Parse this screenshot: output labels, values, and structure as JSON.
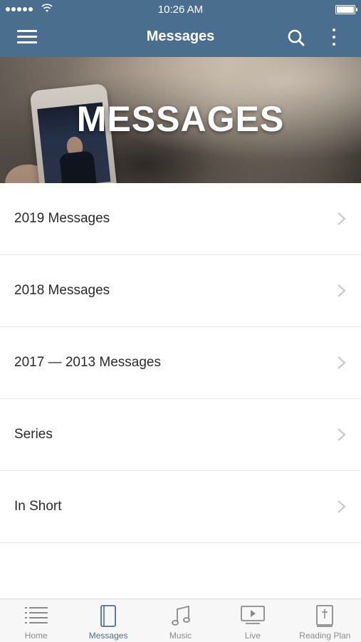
{
  "status_bar": {
    "time": "10:26 AM"
  },
  "nav": {
    "title": "Messages"
  },
  "banner": {
    "title": "MESSAGES"
  },
  "list": [
    {
      "label": "2019 Messages"
    },
    {
      "label": "2018 Messages"
    },
    {
      "label": "2017 — 2013 Messages"
    },
    {
      "label": "Series"
    },
    {
      "label": "In Short"
    }
  ],
  "tabs": [
    {
      "label": "Home",
      "icon": "list-icon"
    },
    {
      "label": "Messages",
      "icon": "book-icon",
      "active": true
    },
    {
      "label": "Music",
      "icon": "music-note-icon"
    },
    {
      "label": "Live",
      "icon": "play-icon"
    },
    {
      "label": "Reading Plan",
      "icon": "bible-icon"
    }
  ],
  "colors": {
    "header": "#4a6f8e",
    "active_tab": "#4a6f8e",
    "inactive_tab": "#8a8a8a"
  }
}
